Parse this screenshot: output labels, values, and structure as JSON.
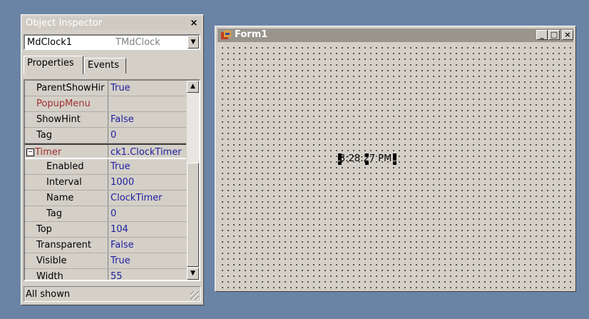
{
  "object_inspector": {
    "title": "Object Inspector",
    "close_glyph": "×",
    "selected_component": "MdClock1",
    "selected_type": "TMdClock",
    "tabs": [
      {
        "label": "Properties",
        "active": true
      },
      {
        "label": "Events",
        "active": false
      }
    ],
    "rows": [
      {
        "name": "ParentShowHir",
        "value": "True",
        "indent": false,
        "color": "#000000"
      },
      {
        "name": "PopupMenu",
        "value": "",
        "indent": false,
        "color": "#a03030"
      },
      {
        "name": "ShowHint",
        "value": "False",
        "indent": false,
        "color": "#000000"
      },
      {
        "name": "Tag",
        "value": "0",
        "indent": false,
        "color": "#000000"
      },
      {
        "name": "Timer",
        "value": "ck1.ClockTimer",
        "indent": false,
        "color": "#a03030",
        "expander": "−",
        "selected": true
      },
      {
        "name": "Enabled",
        "value": "True",
        "indent": true,
        "color": "#000000"
      },
      {
        "name": "Interval",
        "value": "1000",
        "indent": true,
        "color": "#000000"
      },
      {
        "name": "Name",
        "value": "ClockTimer",
        "indent": true,
        "color": "#000000"
      },
      {
        "name": "Tag",
        "value": "0",
        "indent": true,
        "color": "#000000"
      },
      {
        "name": "Top",
        "value": "104",
        "indent": false,
        "color": "#000000"
      },
      {
        "name": "Transparent",
        "value": "False",
        "indent": false,
        "color": "#000000"
      },
      {
        "name": "Visible",
        "value": "True",
        "indent": false,
        "color": "#000000"
      },
      {
        "name": "Width",
        "value": "55",
        "indent": false,
        "color": "#000000"
      }
    ],
    "status": "All shown"
  },
  "form": {
    "title": "Form1",
    "minimize_glyph": "_",
    "maximize_glyph": "□",
    "close_glyph": "×",
    "clock_text": "3:28:27 PM"
  }
}
